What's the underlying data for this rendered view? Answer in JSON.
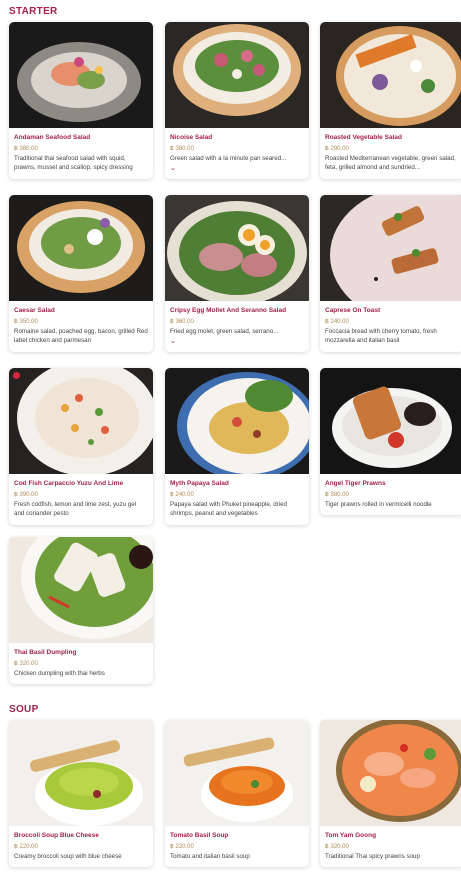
{
  "sections": {
    "starter": {
      "title": "STARTER"
    },
    "soup": {
      "title": "SOUP"
    }
  },
  "currency": "฿",
  "more_icon": "chevron-down-icon",
  "colors": {
    "accent": "#a1224a",
    "price": "#b08a56"
  },
  "starter_items": [
    {
      "name": "Andaman Seafood Salad",
      "price": "฿ 380.00",
      "description": "Traditional thai seafood salad with squid, prawns, mussel and scallop, spicy dressing"
    },
    {
      "name": "Nicoise Salad",
      "price": "฿ 380.00",
      "description": "Green salad with a la minute pan seared...",
      "more": "⌄"
    },
    {
      "name": "Roasted Vegetable Salad",
      "price": "฿ 290.00",
      "description": "Roasted Mediterranean vegetable, green salad, feta, grilled almond and sundried..."
    },
    {
      "name": "Caesar Salad",
      "price": "฿ 350.00",
      "description": "Romaine salad, poached egg, bacon, grilled Red label chicken and parmesan"
    },
    {
      "name": "Cripsy Egg Mollet And Seranno Salad",
      "price": "฿ 360.00",
      "description": "Fried egg molet, green salad, serrano...",
      "more": "⌄"
    },
    {
      "name": "Caprese On Toast",
      "price": "฿ 240.00",
      "description": "Foccacia bread with cherry tomato, fresh mozzarella and italian basil"
    },
    {
      "name": "Cod Fish Carpaccio Yuzu And Lime",
      "price": "฿ 390.00",
      "description": "Fresh codfish, lemon and lime zest, yuzu gel and coriander pesto"
    },
    {
      "name": "Myth Papaya Salad",
      "price": "฿ 240.00",
      "description": "Papaya salad with Phuket pineapple, dried shrimps, peanut and vegetables"
    },
    {
      "name": "Angel Tiger Prawns",
      "price": "฿ 380.00",
      "description": "Tiger prawns rolled in vermicelli noodle"
    },
    {
      "name": "Thai Basil Dumpling",
      "price": "฿ 320.00",
      "description": "Chicken dumpling with thai herbs"
    }
  ],
  "soup_items": [
    {
      "name": "Broccoli Soup Blue Cheese",
      "price": "฿ 220.00",
      "description": "Creamy broccoli soup with blue cheese"
    },
    {
      "name": "Tomato Basil Soup",
      "price": "฿ 220.00",
      "description": "Tomato and italian basil soup"
    },
    {
      "name": "Tom Yam Goong",
      "price": "฿ 320.00",
      "description": "Traditional Thai spicy prawns soup"
    }
  ]
}
